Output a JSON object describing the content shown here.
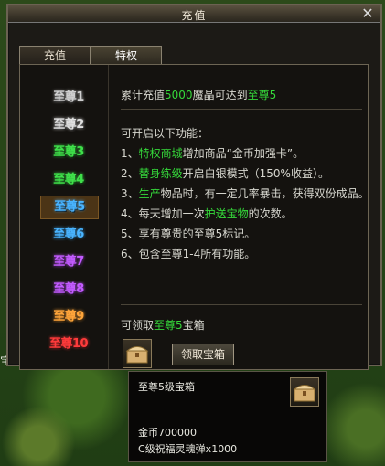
{
  "window": {
    "title": "充值",
    "close_icon": "close-icon"
  },
  "tabs": [
    {
      "label": "充值",
      "active": false
    },
    {
      "label": "特权",
      "active": true
    }
  ],
  "tiers": [
    {
      "label": "至尊1",
      "color": "#cfcfcf"
    },
    {
      "label": "至尊2",
      "color": "#e0e0e0"
    },
    {
      "label": "至尊3",
      "color": "#3fe04a"
    },
    {
      "label": "至尊4",
      "color": "#3fe04a"
    },
    {
      "label": "至尊5",
      "color": "#49b4ff",
      "selected": true
    },
    {
      "label": "至尊6",
      "color": "#49b4ff"
    },
    {
      "label": "至尊7",
      "color": "#c35bff"
    },
    {
      "label": "至尊8",
      "color": "#c35bff"
    },
    {
      "label": "至尊9",
      "color": "#ffa53a"
    },
    {
      "label": "至尊10",
      "color": "#ff3b3b"
    }
  ],
  "summary": {
    "prefix": "累计充值",
    "amount": "5000",
    "mid": "魔晶可达到",
    "level": "至尊5"
  },
  "features_title": "可开启以下功能：",
  "features": [
    {
      "num": "1、",
      "hl": "特权商城",
      "rest": "增加商品“金币加强卡”。"
    },
    {
      "num": "2、",
      "hl": "替身练级",
      "rest": "开启白银模式（150%收益）。"
    },
    {
      "num": "3、",
      "hl": "生产",
      "rest": "物品时，有一定几率暴击，获得双份成品。"
    },
    {
      "num": "4、",
      "pre": "每天增加一次",
      "hl": "护送宝物",
      "rest": "的次数。"
    },
    {
      "num": "5、",
      "rest": "享有尊贵的至尊5标记。"
    },
    {
      "num": "6、",
      "rest": "包含至尊1-4所有功能。"
    }
  ],
  "claim": {
    "prefix": "可领取",
    "level": "至尊5",
    "suffix": "宝箱",
    "button": "领取宝箱"
  },
  "tooltip": {
    "title": "至尊5级宝箱",
    "gold": "金币700000",
    "item": "C级祝福灵魂弹x1000"
  },
  "background": {
    "side_text": "宝"
  }
}
